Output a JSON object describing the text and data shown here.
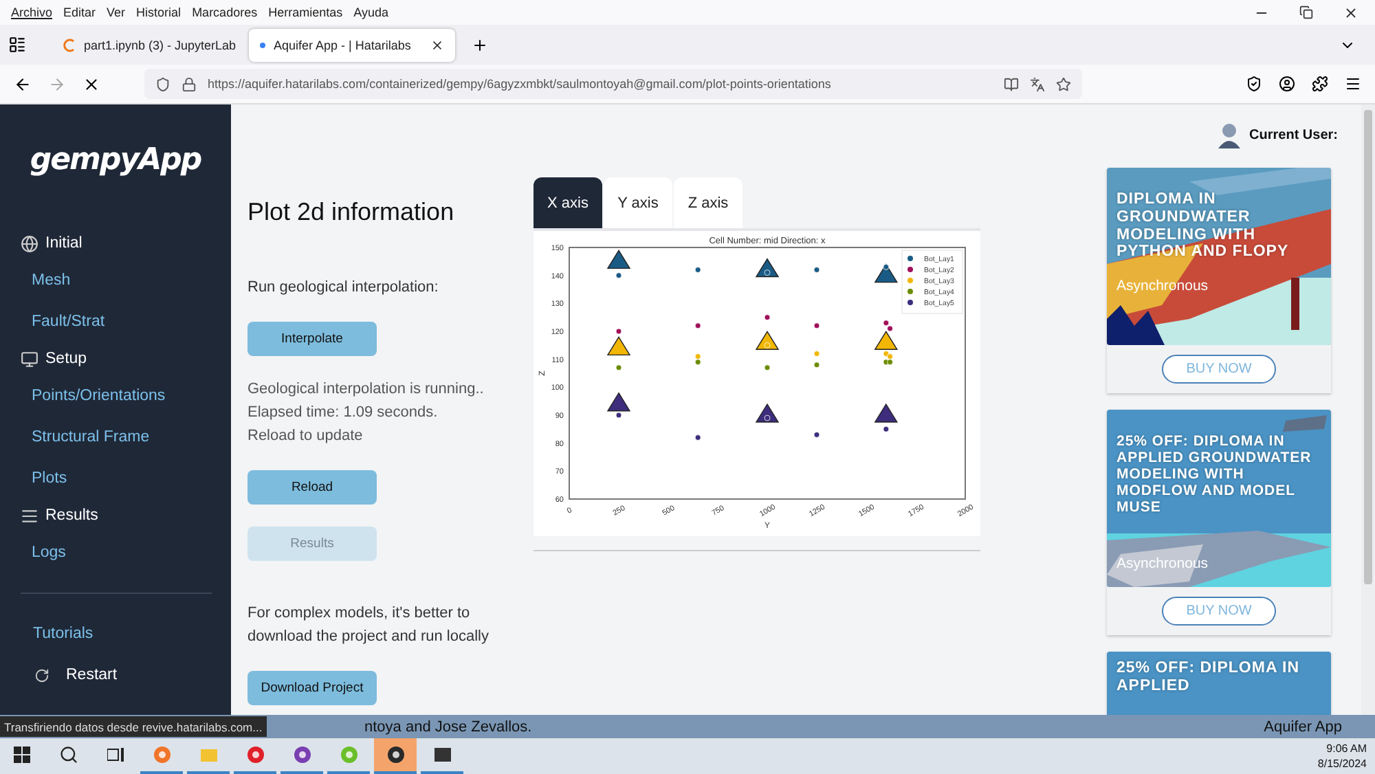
{
  "browser": {
    "menu": [
      "Archivo",
      "Editar",
      "Ver",
      "Historial",
      "Marcadores",
      "Herramientas",
      "Ayuda"
    ],
    "tabs": [
      {
        "title": "part1.ipynb (3) - JupyterLab",
        "selected": false
      },
      {
        "title": "Aquifer App - | Hatarilabs",
        "selected": true
      }
    ],
    "url": "https://aquifer.hatarilabs.com/containerized/gempy/6agyzxmbkt/saulmontoyah@gmail.com/plot-points-orientations"
  },
  "sidebar": {
    "logo": "gempyApp",
    "items": [
      {
        "label": "Initial",
        "kind": "section"
      },
      {
        "label": "Mesh",
        "kind": "link"
      },
      {
        "label": "Fault/Strat",
        "kind": "link"
      },
      {
        "label": "Setup",
        "kind": "section"
      },
      {
        "label": "Points/Orientations",
        "kind": "link"
      },
      {
        "label": "Structural Frame",
        "kind": "link"
      },
      {
        "label": "Plots",
        "kind": "link"
      },
      {
        "label": "Results",
        "kind": "section"
      },
      {
        "label": "Logs",
        "kind": "link"
      }
    ],
    "footer": [
      {
        "label": "Tutorials",
        "kind": "link"
      },
      {
        "label": "Restart",
        "kind": "action"
      }
    ]
  },
  "main": {
    "blocks": [
      {
        "kind": "heading",
        "text": "Plot 2d information"
      },
      {
        "kind": "text",
        "lines": [
          "Run geological interpolation:"
        ]
      },
      {
        "kind": "button",
        "label": "Interpolate",
        "disabled": false
      },
      {
        "kind": "status",
        "lines": [
          "Geological interpolation is running..",
          "Elapsed time: 1.09 seconds.",
          "Reload to update"
        ]
      },
      {
        "kind": "button",
        "label": "Reload",
        "disabled": false
      },
      {
        "kind": "button",
        "label": "Results",
        "disabled": true
      },
      {
        "kind": "text",
        "lines": [
          "For complex models, it's better to",
          "download the project and run locally"
        ]
      },
      {
        "kind": "button",
        "label": "Download Project",
        "disabled": false
      }
    ]
  },
  "plot": {
    "tabs": [
      {
        "label": "X axis",
        "selected": true
      },
      {
        "label": "Y axis",
        "selected": false
      },
      {
        "label": "Z axis",
        "selected": false
      }
    ],
    "chart_data": {
      "type": "scatter",
      "title": "Cell Number: mid Direction: x",
      "xlabel": "Y",
      "ylabel": "Z",
      "xlim": [
        0,
        2000
      ],
      "ylim": [
        60,
        150
      ],
      "xticks": [
        {
          "value": 0,
          "label": "0"
        },
        {
          "value": 250,
          "label": "250"
        },
        {
          "value": 500,
          "label": "500"
        },
        {
          "value": 750,
          "label": "750"
        },
        {
          "value": 1000,
          "label": "1000"
        },
        {
          "value": 1250,
          "label": "1250"
        },
        {
          "value": 1500,
          "label": "1500"
        },
        {
          "value": 1750,
          "label": "1750"
        },
        {
          "value": 2000,
          "label": "2000"
        }
      ],
      "yticks": [
        {
          "value": 60,
          "label": "60"
        },
        {
          "value": 70,
          "label": "70"
        },
        {
          "value": 80,
          "label": "80"
        },
        {
          "value": 90,
          "label": "90"
        },
        {
          "value": 100,
          "label": "100"
        },
        {
          "value": 110,
          "label": "110"
        },
        {
          "value": 120,
          "label": "120"
        },
        {
          "value": 130,
          "label": "130"
        },
        {
          "value": 140,
          "label": "140"
        },
        {
          "value": 150,
          "label": "150"
        }
      ],
      "series": [
        {
          "name": "Bot_Lay1",
          "color": "#1a5b86",
          "x": [
            250,
            650,
            1000,
            1250,
            1600
          ],
          "values": [
            140,
            142,
            141,
            142,
            143
          ]
        },
        {
          "name": "Bot_Lay2",
          "color": "#a0105a",
          "x": [
            250,
            650,
            1000,
            1250,
            1600,
            1620
          ],
          "values": [
            120,
            122,
            125,
            122,
            123,
            121
          ]
        },
        {
          "name": "Bot_Lay3",
          "color": "#f2b705",
          "x": [
            650,
            1000,
            1250,
            1600,
            1620
          ],
          "values": [
            111,
            115,
            112,
            112,
            111
          ]
        },
        {
          "name": "Bot_Lay4",
          "color": "#6b8c00",
          "x": [
            250,
            650,
            1000,
            1250,
            1600,
            1620
          ],
          "values": [
            107,
            109,
            107,
            108,
            109,
            109
          ]
        },
        {
          "name": "Bot_Lay5",
          "color": "#3d2d7c",
          "x": [
            250,
            650,
            1000,
            1250,
            1600
          ],
          "values": [
            90,
            82,
            89,
            83,
            85
          ]
        },
        {
          "marker": "triangle",
          "color": "#1a5b86",
          "x": [
            250,
            1000,
            1600
          ],
          "values": [
            145,
            142,
            140
          ]
        },
        {
          "marker": "triangle",
          "color": "#f2b705",
          "x": [
            250,
            1000,
            1600
          ],
          "values": [
            114,
            116,
            116
          ]
        },
        {
          "marker": "triangle",
          "color": "#3d2d7c",
          "x": [
            250,
            1000,
            1600
          ],
          "values": [
            94,
            90,
            90
          ]
        }
      ],
      "legend": "upper right"
    }
  },
  "user": {
    "label": "Current User:"
  },
  "ads": [
    {
      "title": "DIPLOMA IN GROUNDWATER MODELING WITH PYTHON AND FLOPY",
      "subtitle": "Asynchronous",
      "button": "BUY NOW"
    },
    {
      "title": "25% OFF: DIPLOMA IN APPLIED GROUNDWATER MODELING WITH MODFLOW AND MODEL MUSE",
      "subtitle": "Asynchronous",
      "button": "BUY NOW"
    },
    {
      "title": "25% OFF: DIPLOMA IN APPLIED"
    }
  ],
  "status_bar": {
    "text": "ntoya and Jose Zevallos.",
    "app": "Aquifer App",
    "tooltip": "Transfiriendo datos desde revive.hatarilabs.com..."
  },
  "taskbar": {
    "apps": [
      {
        "selected": false
      },
      {
        "selected": false
      },
      {
        "selected": false
      },
      {
        "selected": false
      },
      {
        "selected": false
      },
      {
        "selected": true
      },
      {
        "selected": false
      }
    ],
    "time": "9:06 AM",
    "date": "8/15/2024"
  }
}
